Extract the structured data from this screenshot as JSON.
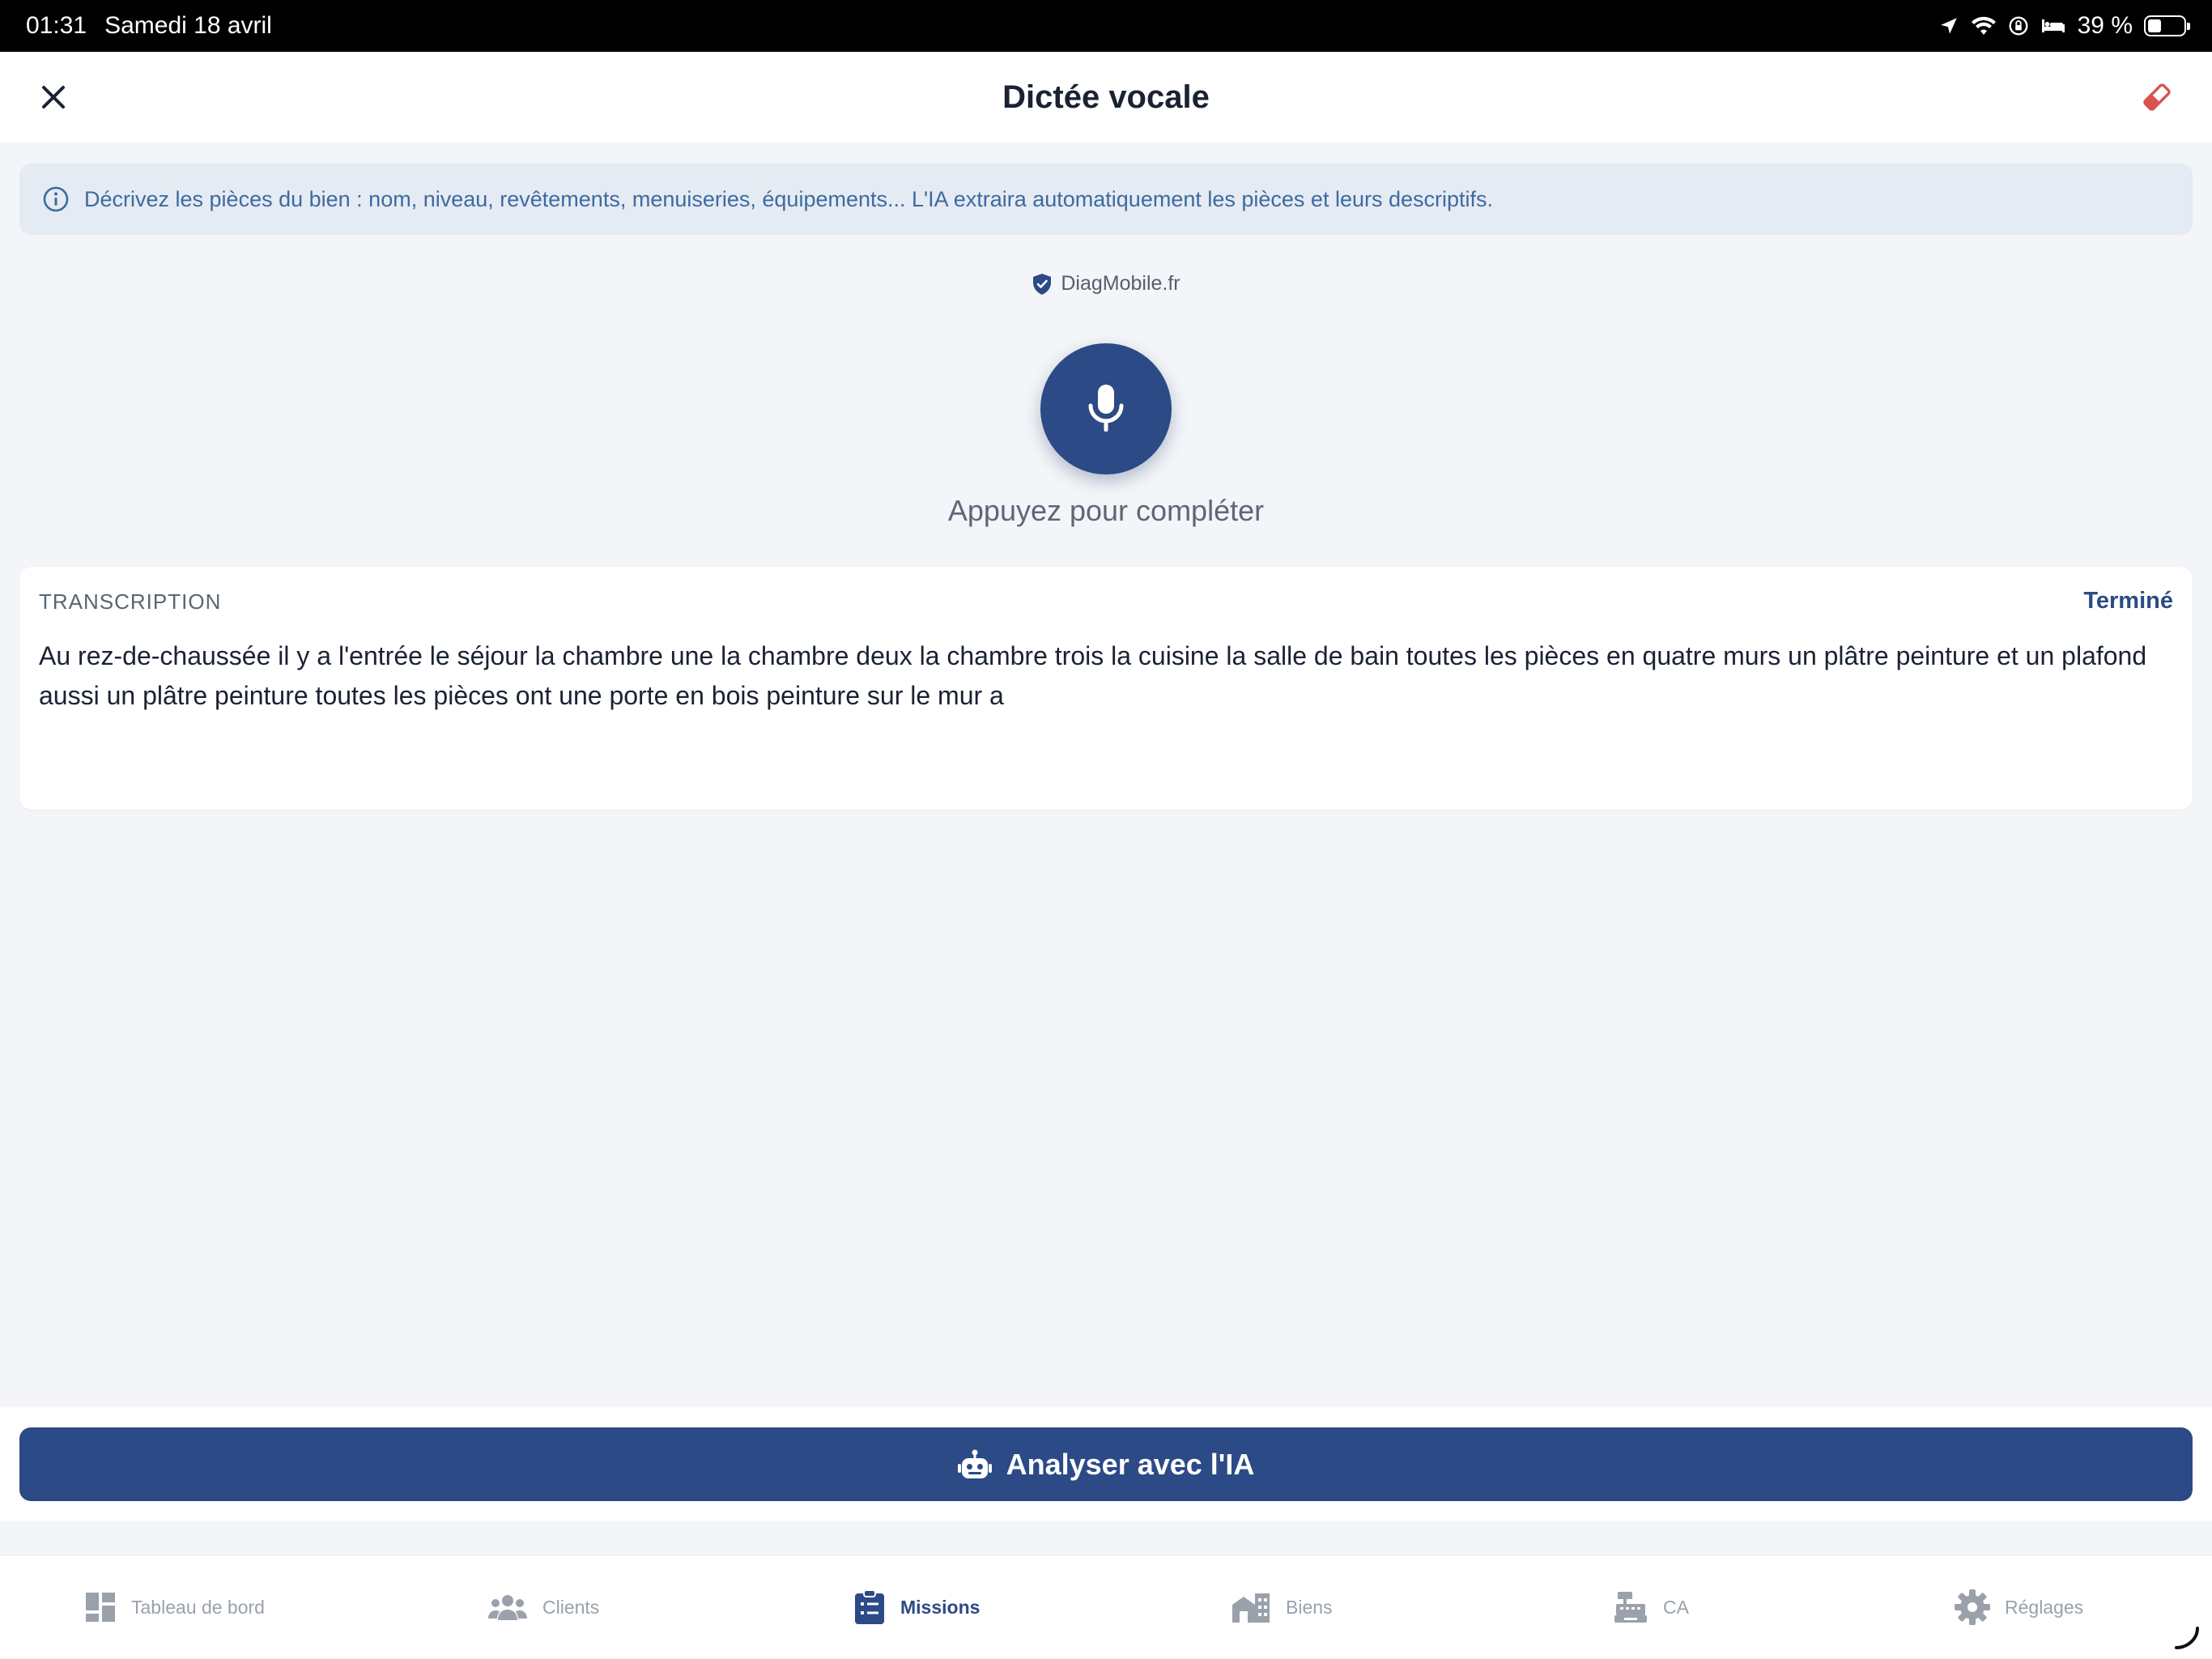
{
  "status_bar": {
    "time": "01:31",
    "date": "Samedi 18 avril",
    "battery": "39 %",
    "battery_level": 0.39
  },
  "header": {
    "title": "Dictée vocale"
  },
  "info": {
    "text": "Décrivez les pièces du bien : nom, niveau, revêtements, menuiseries, équipements... L'IA extraira automatiquement les pièces et leurs descriptifs."
  },
  "brand": {
    "name": "DiagMobile.fr"
  },
  "mic": {
    "hint": "Appuyez pour compléter"
  },
  "transcription": {
    "label": "TRANSCRIPTION",
    "done_label": "Terminé",
    "text": "Au rez-de-chaussée il y a l'entrée le séjour la chambre une la chambre deux la chambre trois la cuisine la salle de bain toutes les pièces en quatre murs un plâtre peinture et un plafond aussi un plâtre peinture toutes les pièces ont une porte en bois peinture sur le mur a"
  },
  "actions": {
    "analyse_label": "Analyser avec l'IA"
  },
  "tabbar": {
    "items": [
      {
        "label": "Tableau de bord",
        "icon": "dashboard-icon"
      },
      {
        "label": "Clients",
        "icon": "users-icon"
      },
      {
        "label": "Missions",
        "icon": "clipboard-list-icon",
        "active": true
      },
      {
        "label": "Biens",
        "icon": "city-icon"
      },
      {
        "label": "CA",
        "icon": "cash-register-icon"
      },
      {
        "label": "Réglages",
        "icon": "gear-icon"
      }
    ]
  },
  "colors": {
    "primary": "#2c4a86",
    "info_bg": "#e5ebf2",
    "info_text": "#3d6aa3",
    "eraser": "#d9534f",
    "inactive": "#9aa1ab"
  }
}
